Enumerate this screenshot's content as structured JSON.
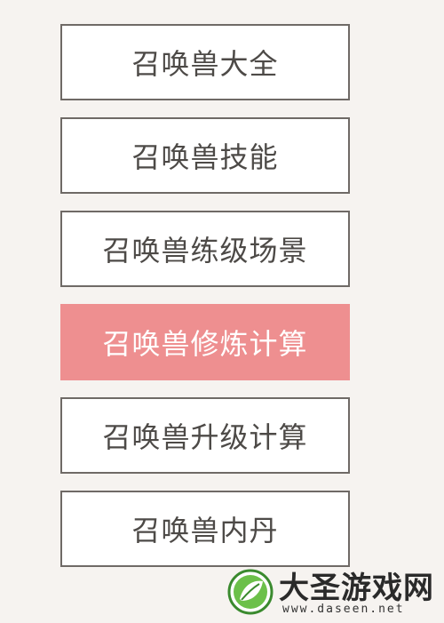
{
  "menu": {
    "items": [
      {
        "label": "召唤兽大全",
        "active": false
      },
      {
        "label": "召唤兽技能",
        "active": false
      },
      {
        "label": "召唤兽练级场景",
        "active": false
      },
      {
        "label": "召唤兽修炼计算",
        "active": true
      },
      {
        "label": "召唤兽升级计算",
        "active": false
      },
      {
        "label": "召唤兽内丹",
        "active": false
      }
    ],
    "active_color": "#ee8f90"
  },
  "watermark": {
    "title": "大圣游戏网",
    "url": "www.daseen.net",
    "logo_icon": "green-leaf-circle-logo"
  }
}
